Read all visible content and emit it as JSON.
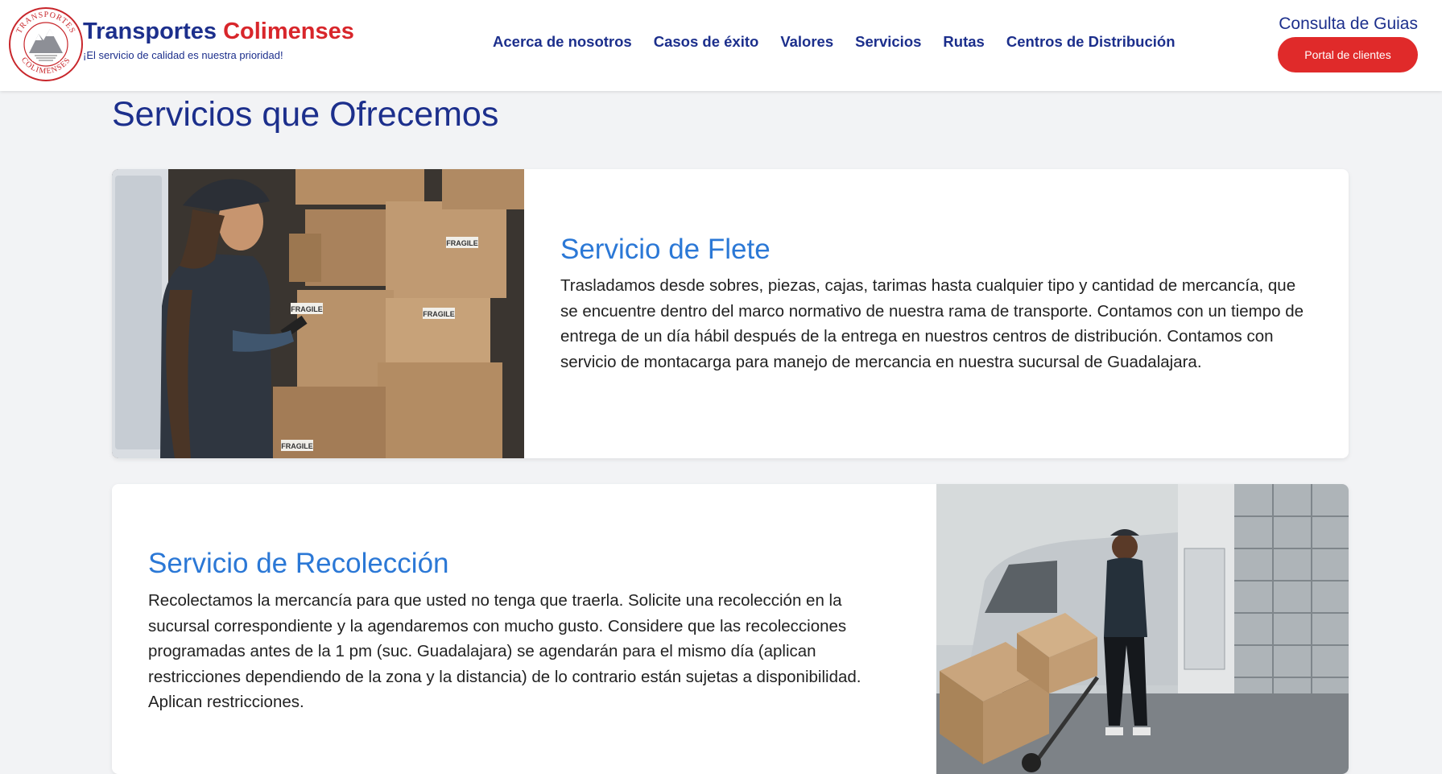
{
  "brand": {
    "name_part1": "Transportes",
    "name_part2": "Colimenses",
    "tagline": "¡El servicio de calidad es nuestra prioridad!",
    "seal_top_text": "TRANSPORTES",
    "seal_bottom_text": "COLIMENSES",
    "colors": {
      "primary": "#1c2f8c",
      "accent": "#d8262b",
      "link": "#2b78d6"
    }
  },
  "nav": {
    "items": [
      {
        "label": "Acerca de nosotros"
      },
      {
        "label": "Casos de éxito"
      },
      {
        "label": "Valores"
      },
      {
        "label": "Servicios"
      },
      {
        "label": "Rutas"
      },
      {
        "label": "Centros de Distribución"
      }
    ]
  },
  "header": {
    "consulta_label": "Consulta de Guias",
    "portal_button": "Portal de clientes"
  },
  "main": {
    "title": "Servicios que Ofrecemos",
    "services": [
      {
        "title": "Servicio de Flete",
        "description": "Trasladamos desde sobres, piezas, cajas, tarimas hasta cualquier tipo y cantidad de mercancía, que se encuentre dentro del marco normativo de nuestra rama de transporte. Contamos con un tiempo de entrega de un día hábil después de la entrega en nuestros centros de distribución. Contamos con servicio de montacarga para manejo de mercancia en nuestra sucursal de Guadalajara.",
        "image_labels": [
          "FRAGILE",
          "FRAGILE",
          "FRAGILE",
          "FRAGILE"
        ]
      },
      {
        "title": "Servicio de Recolección",
        "description": "Recolectamos la mercancía para que usted no tenga que traerla. Solicite una recolección en la sucursal correspondiente y la agendaremos con mucho gusto. Considere que las recolecciones programadas antes de la 1 pm (suc. Guadalajara) se agendarán para el mismo día (aplican restricciones dependiendo de la zona y la distancia) de lo contrario están sujetas a disponibilidad. Aplican restricciones."
      }
    ]
  }
}
